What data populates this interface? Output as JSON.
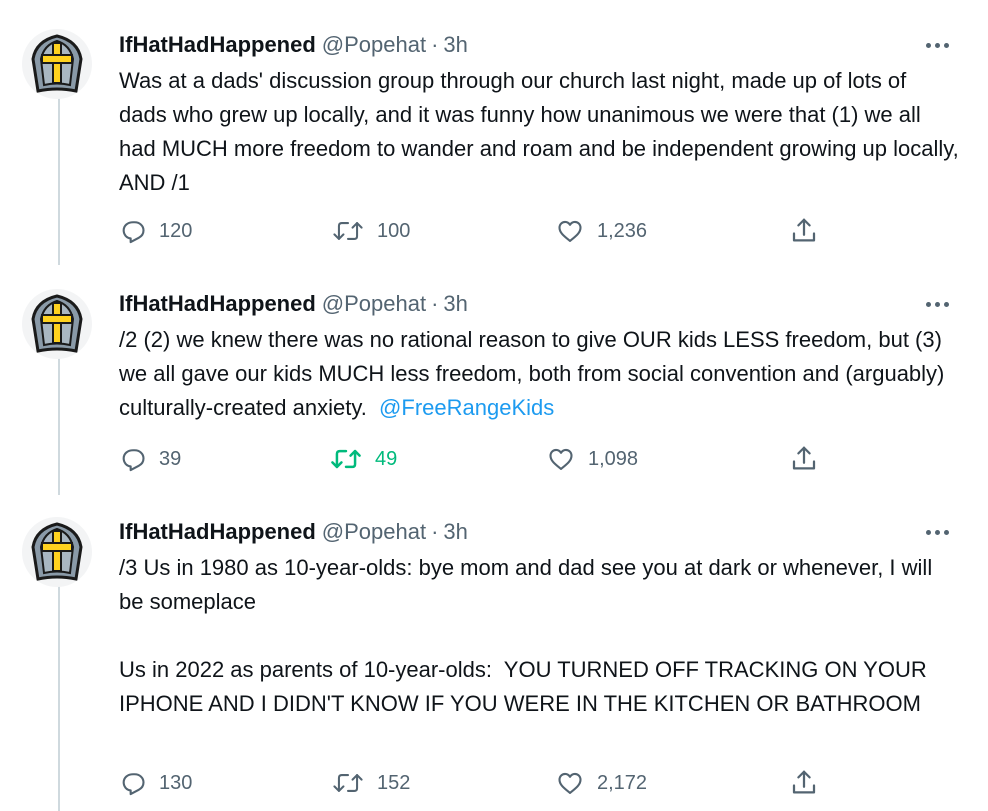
{
  "tweets": [
    {
      "name": "IfHatHadHappened",
      "handle": "@Popehat",
      "separator": "·",
      "time": "3h",
      "text": "Was at a dads' discussion group through our church last night, made up of lots of dads who grew up locally, and it was funny how unanimous we were that (1) we all had MUCH more freedom to wander and roam and be independent growing up locally, AND /1",
      "mention": "",
      "replies": "120",
      "retweets": "100",
      "likes": "1,236",
      "retweeted": false
    },
    {
      "name": "IfHatHadHappened",
      "handle": "@Popehat",
      "separator": "·",
      "time": "3h",
      "text": "/2 (2) we knew there was no rational reason to give OUR kids LESS freedom, but (3) we all gave our kids MUCH less freedom, both from social convention and (arguably) culturally-created anxiety.  ",
      "mention": "@FreeRangeKids",
      "replies": "39",
      "retweets": "49",
      "likes": "1,098",
      "retweeted": true
    },
    {
      "name": "IfHatHadHappened",
      "handle": "@Popehat",
      "separator": "·",
      "time": "3h",
      "text": "/3 Us in 1980 as 10-year-olds: bye mom and dad see you at dark or whenever, I will be someplace\n\nUs in 2022 as parents of 10-year-olds:  YOU TURNED OFF TRACKING ON YOUR IPHONE AND I DIDN'T KNOW IF YOU WERE IN THE KITCHEN OR BATHROOM",
      "mention": "",
      "replies": "130",
      "retweets": "152",
      "likes": "2,172",
      "retweeted": false
    }
  ],
  "colors": {
    "text": "#0f1419",
    "secondary": "#536471",
    "link": "#1d9bf0",
    "retweet_active": "#00ba7c",
    "thread_line": "#cfd9de"
  },
  "icons": [
    "pope-hat-avatar",
    "more-icon",
    "reply-icon",
    "retweet-icon",
    "like-icon",
    "share-icon"
  ]
}
